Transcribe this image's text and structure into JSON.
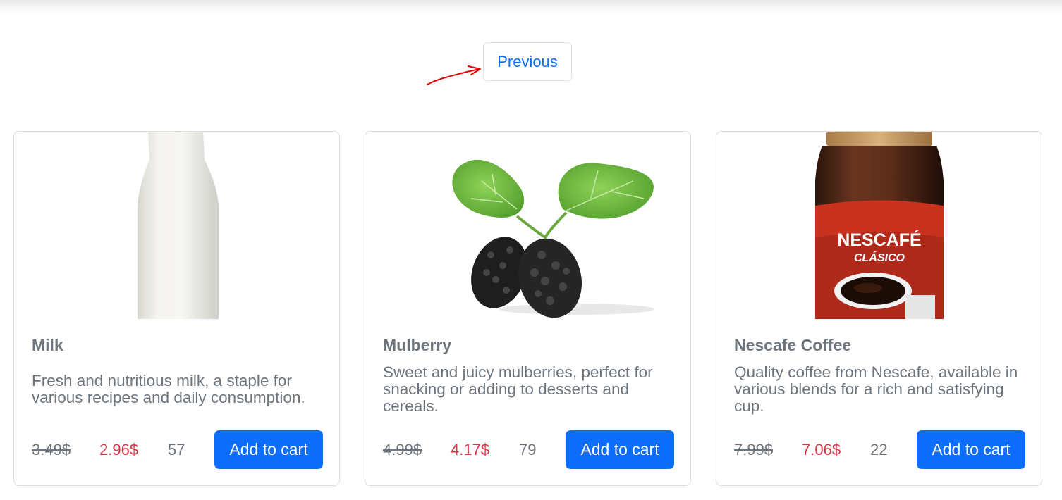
{
  "pagination": {
    "previous_label": "Previous"
  },
  "colors": {
    "accent": "#0d6efd",
    "sale_price": "#dc3545",
    "muted_text": "#6c757d",
    "annotation": "#e00000"
  },
  "products": [
    {
      "name": "Milk",
      "description": "Fresh and nutritious milk, a staple for various recipes and daily consumption.",
      "old_price": "3.49$",
      "new_price": "2.96$",
      "stock": "57",
      "button_label": "Add to cart",
      "image_icon": "milk-bottle-image"
    },
    {
      "name": "Mulberry",
      "description": "Sweet and juicy mulberries, perfect for snacking or adding to desserts and cereals.",
      "old_price": "4.99$",
      "new_price": "4.17$",
      "stock": "79",
      "button_label": "Add to cart",
      "image_icon": "mulberry-image"
    },
    {
      "name": "Nescafe Coffee",
      "description": "Quality coffee from Nescafe, available in various blends for a rich and satisfying cup.",
      "old_price": "7.99$",
      "new_price": "7.06$",
      "stock": "22",
      "button_label": "Add to cart",
      "image_icon": "coffee-jar-image",
      "jar_brand": "NESCAFÉ",
      "jar_subtitle": "CLÁSICO"
    }
  ]
}
